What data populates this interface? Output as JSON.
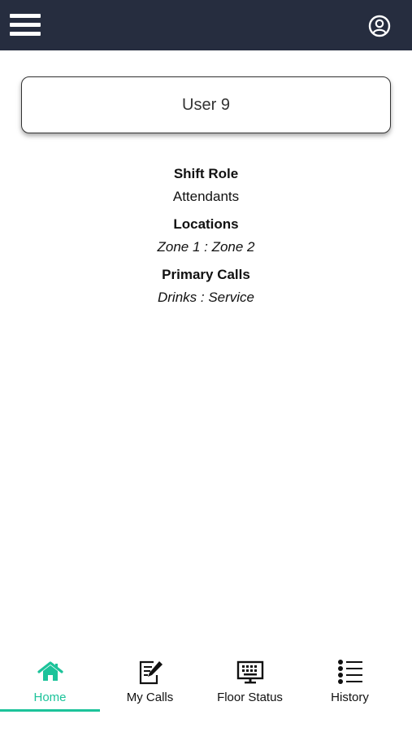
{
  "colors": {
    "header_bg": "#262d3f",
    "accent": "#1cc39a"
  },
  "header": {
    "menu_icon": "hamburger-menu-icon",
    "profile_icon": "user-circle-icon"
  },
  "user_card": {
    "name": "User 9"
  },
  "details": {
    "shift_role_label": "Shift Role",
    "shift_role_value": "Attendants",
    "locations_label": "Locations",
    "locations_value": "Zone 1 : Zone 2",
    "primary_calls_label": "Primary Calls",
    "primary_calls_value": "Drinks : Service"
  },
  "tabs": [
    {
      "label": "Home",
      "icon": "home-icon",
      "active": true
    },
    {
      "label": "My Calls",
      "icon": "edit-document-icon",
      "active": false
    },
    {
      "label": "Floor Status",
      "icon": "monitor-keypad-icon",
      "active": false
    },
    {
      "label": "History",
      "icon": "list-icon",
      "active": false
    }
  ]
}
